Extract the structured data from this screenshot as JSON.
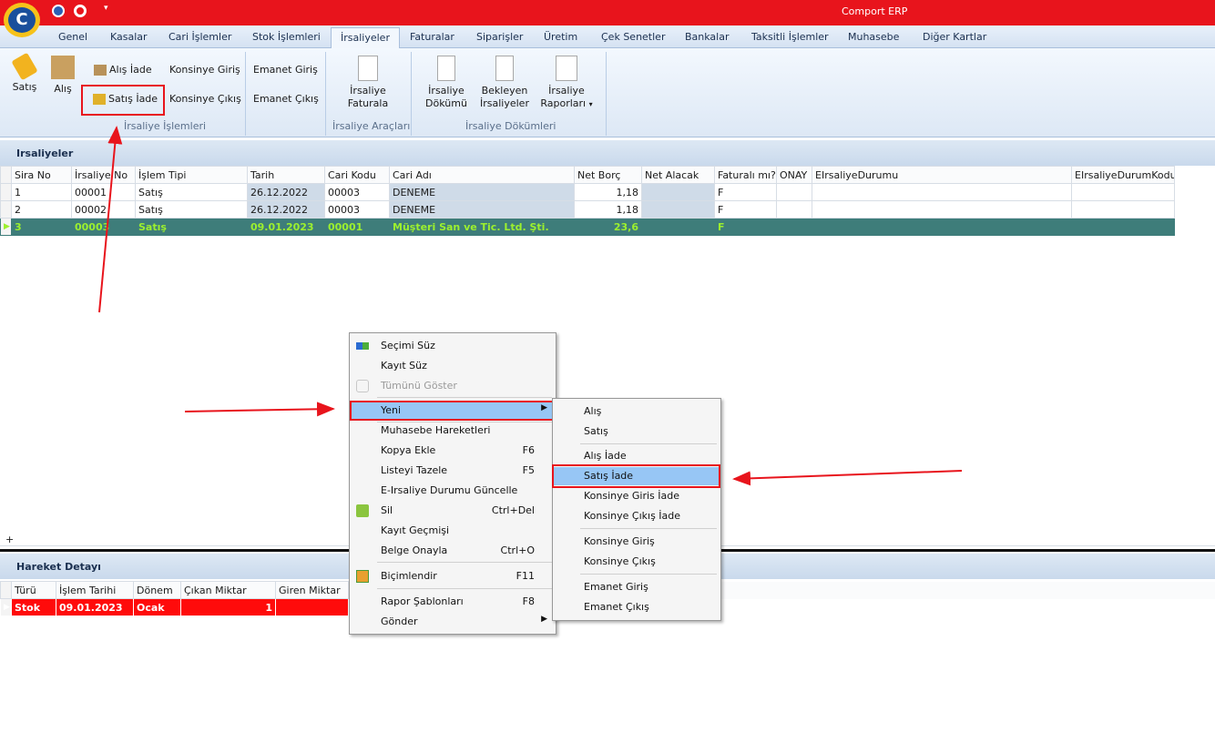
{
  "app": {
    "title": "Comport ERP"
  },
  "tabs": [
    "Genel",
    "Kasalar",
    "Cari İşlemler",
    "Stok İşlemleri",
    "İrsaliyeler",
    "Faturalar",
    "Siparişler",
    "Üretim",
    "Çek Senetler",
    "Bankalar",
    "Taksitli İşlemler",
    "Muhasebe",
    "Diğer Kartlar"
  ],
  "ribbon": {
    "satis": "Satış",
    "alis": "Alış",
    "alis_iade": "Alış İade",
    "satis_iade": "Satış İade",
    "konsinye_giris": "Konsinye Giriş",
    "konsinye_cikis": "Konsinye Çıkış",
    "emanet_giris": "Emanet Giriş",
    "emanet_cikis": "Emanet Çıkış",
    "group1": "İrsaliye İşlemleri",
    "irsaliye_faturala_1": "İrsaliye",
    "irsaliye_faturala_2": "Faturala",
    "group2": "İrsaliye Araçları",
    "dokumu_1": "İrsaliye",
    "dokumu_2": "Dökümü",
    "bekleyen_1": "Bekleyen",
    "bekleyen_2": "İrsaliyeler",
    "raporlari_1": "İrsaliye",
    "raporlari_2": "Raporları",
    "group3": "İrsaliye Dökümleri"
  },
  "irsaliyeler": {
    "title": "Irsaliyeler",
    "columns": [
      "Sira No",
      "İrsaliye No",
      "İşlem Tipi",
      "Tarih",
      "Cari Kodu",
      "Cari Adı",
      "Net Borç",
      "Net Alacak",
      "Faturalı mı?",
      "ONAY",
      "EIrsaliyeDurumu",
      "EIrsaliyeDurumKodu"
    ],
    "rows": [
      [
        "1",
        "00001",
        "Satış",
        "26.12.2022",
        "00003",
        "DENEME",
        "1,18",
        "",
        "F",
        "",
        "",
        ""
      ],
      [
        "2",
        "00002",
        "Satış",
        "26.12.2022",
        "00003",
        "DENEME",
        "1,18",
        "",
        "F",
        "",
        "",
        ""
      ],
      [
        "3",
        "00003",
        "Satış",
        "09.01.2023",
        "00001",
        "Müşteri San ve Tic. Ltd. Şti.",
        "23,6",
        "",
        "F",
        "",
        "",
        ""
      ]
    ],
    "new_row_mark": "+"
  },
  "hareket": {
    "title": "Hareket Detayı",
    "columns": [
      "Türü",
      "İşlem Tarihi",
      "Dönem",
      "Çıkan Miktar",
      "Giren Miktar"
    ],
    "row": [
      "Stok",
      "09.01.2023",
      "Ocak",
      "1",
      ""
    ]
  },
  "context_menu": {
    "secimi_suz": "Seçimi Süz",
    "kayit_suz": "Kayıt Süz",
    "tumunu_goster": "Tümünü Göster",
    "yeni": "Yeni",
    "muhasebe": "Muhasebe Hareketleri",
    "kopya": "Kopya Ekle",
    "kopya_sc": "F6",
    "tazele": "Listeyi Tazele",
    "tazele_sc": "F5",
    "e_irsaliye": "E-Irsaliye Durumu Güncelle",
    "sil": "Sil",
    "sil_sc": "Ctrl+Del",
    "gecmis": "Kayıt Geçmişi",
    "onayla": "Belge Onayla",
    "onayla_sc": "Ctrl+O",
    "bicim": "Biçimlendir",
    "bicim_sc": "F11",
    "rapor": "Rapor Şablonları",
    "rapor_sc": "F8",
    "gonder": "Gönder"
  },
  "submenu": {
    "alis": "Alış",
    "satis": "Satış",
    "alis_iade": "Alış İade",
    "satis_iade": "Satış İade",
    "konsinye_giris_iade": "Konsinye Giris İade",
    "konsinye_cikis_iade": "Konsinye Çıkış İade",
    "konsinye_giris": "Konsinye Giriş",
    "konsinye_cikis": "Konsinye Çıkış",
    "emanet_giris": "Emanet Giriş",
    "emanet_cikis": "Emanet Çıkış"
  },
  "colors": {
    "title_red": "#e8141c",
    "selected_teal": "#3e7d7a",
    "selected_text": "#9cf02e",
    "hover_blue": "#97c6f5"
  }
}
